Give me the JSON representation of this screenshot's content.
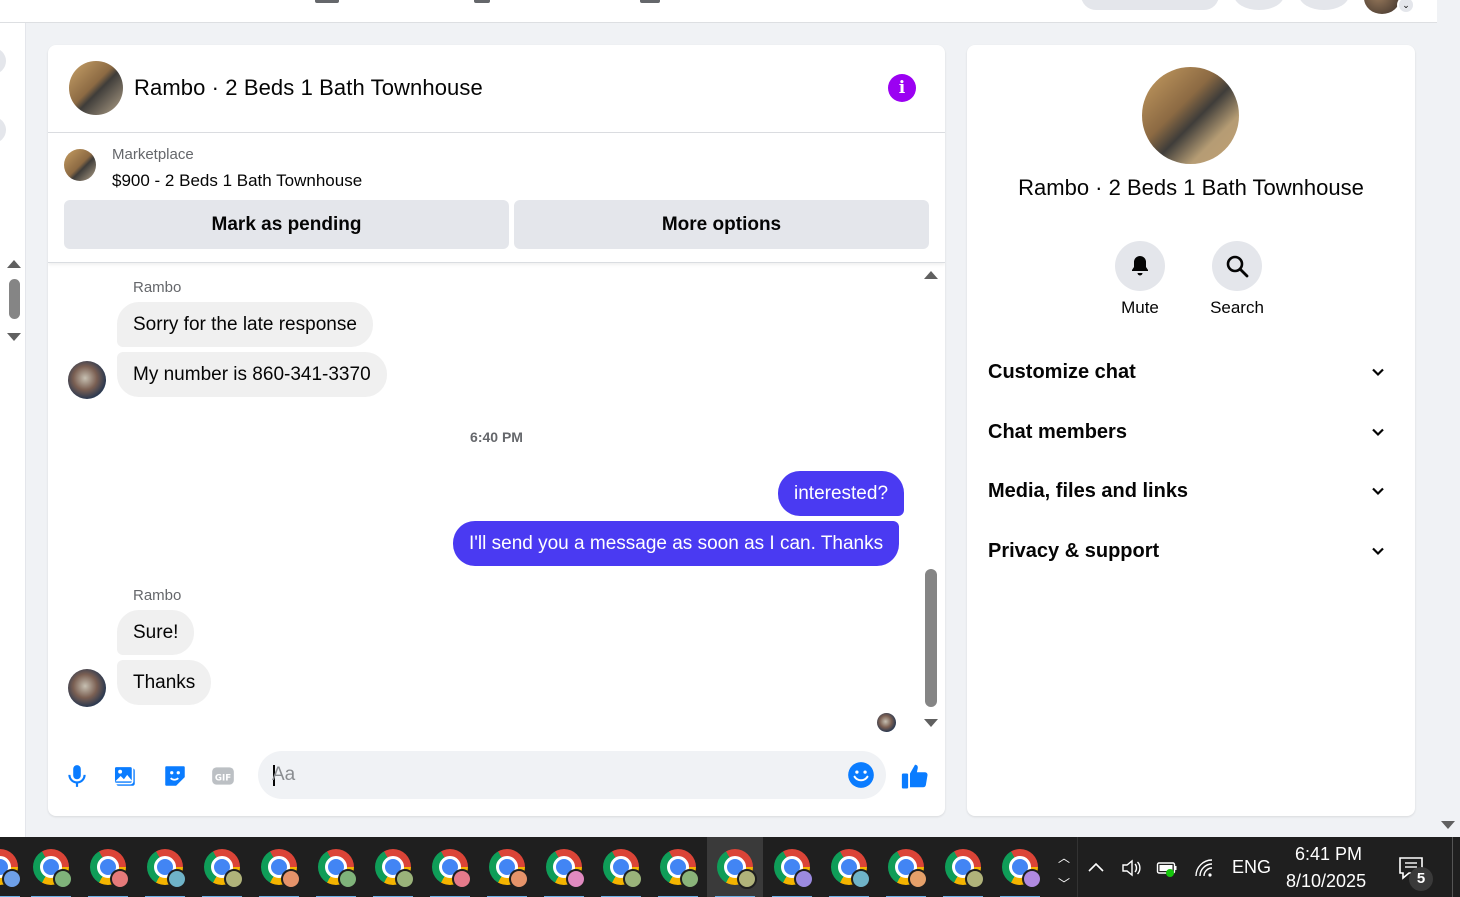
{
  "chat": {
    "title": "Rambo · 2 Beds 1 Bath Townhouse",
    "listing": {
      "source": "Marketplace",
      "price_title": "$900 - 2 Beds 1 Bath Townhouse"
    },
    "buttons": {
      "mark_pending": "Mark as pending",
      "more_options": "More options"
    },
    "messages": {
      "group1_sender": "Rambo",
      "group1_msg1": "Sorry for the late response",
      "group1_msg2": "My number is 860-341-3370",
      "timestamp": "6:40 PM",
      "mine_msg1": "interested?",
      "mine_msg2": "I'll send you a message as soon as I can. Thanks",
      "group2_sender": "Rambo",
      "group2_msg1": "Sure!",
      "group2_msg2": "Thanks"
    },
    "composer": {
      "placeholder": "Aa"
    }
  },
  "info_panel": {
    "title": "Rambo · 2 Beds 1 Bath Townhouse",
    "actions": {
      "mute": "Mute",
      "search": "Search"
    },
    "sections": {
      "customize": "Customize chat",
      "members": "Chat members",
      "media": "Media, files and links",
      "privacy": "Privacy & support"
    }
  },
  "taskbar": {
    "language": "ENG",
    "time": "6:41 PM",
    "date": "8/10/2025",
    "notification_count": "5"
  },
  "colors": {
    "accent": "#4a3af2",
    "info_button": "#9b01f2",
    "messenger_blue": "#0a7cff"
  }
}
